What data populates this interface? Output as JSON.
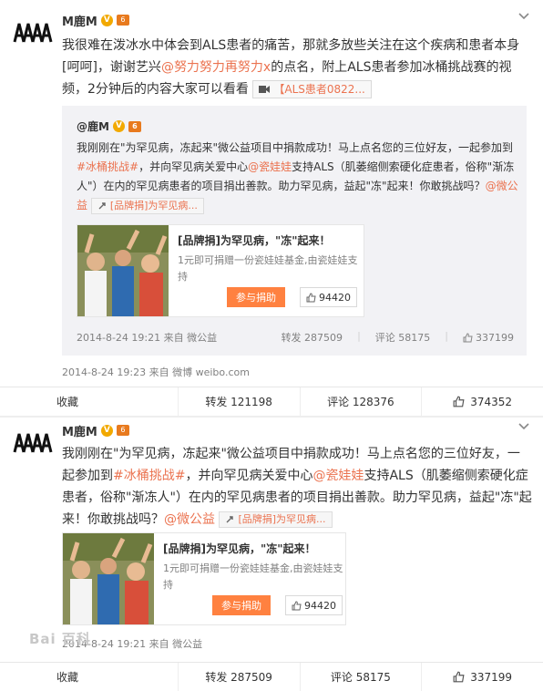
{
  "colors": {
    "accent": "#eb7350",
    "button": "#ff8140",
    "quote_bg": "#f2f2f5",
    "muted": "#808080"
  },
  "posts": [
    {
      "author": "M鹿M",
      "vip_badge": "V",
      "level_badge": "6",
      "text_parts": [
        "我很难在泼冰水中体会到ALS患者的痛苦，那就多放些关注在这个疾病和患者本身[呵呵]，谢谢艺兴",
        "@努力努力再努力x",
        "的点名，附上ALS患者参加冰桶挑战赛的视频，2分钟后的内容大家可以看看",
        "【ALS患者0822..."
      ],
      "quote": {
        "author": "@鹿M",
        "text_parts": [
          "我刚刚在\"为罕见病，冻起来\"微公益项目中捐款成功！马上点名您的三位好友，一起参加到",
          "#冰桶挑战#",
          "，并向罕见病关爱中心",
          "@瓷娃娃",
          "支持ALS（肌萎缩侧索硬化症患者，俗称\"渐冻人\"）在内的罕见病患者的项目捐出善款。助力罕见病，益起\"冻\"起来！你敢挑战吗？",
          "@微公益",
          "[品牌捐]为罕见病..."
        ],
        "card": {
          "title": "[品牌捐]为罕见病，\"冻\"起来！",
          "desc": "1元即可捐赠一份瓷娃娃基金,由瓷娃娃支持",
          "button": "参与捐助",
          "likes": "94420"
        },
        "time": "2014-8-24 19:21 来自 微公益",
        "repost": "转发 287509",
        "comment": "评论 58175",
        "likes": "337199"
      },
      "time": "2014-8-24 19:23 来自 微博 weibo.com",
      "actions": {
        "fav": "收藏",
        "repost": "转发 121198",
        "comment": "评论 128376",
        "likes": "374352"
      }
    },
    {
      "author": "M鹿M",
      "vip_badge": "V",
      "level_badge": "6",
      "text_parts": [
        "我刚刚在\"为罕见病，冻起来\"微公益项目中捐款成功！马上点名您的三位好友，一起参加到",
        "#冰桶挑战#",
        "，并向罕见病关爱中心",
        "@瓷娃娃",
        "支持ALS（肌萎缩侧索硬化症患者，俗称\"渐冻人\"）在内的罕见病患者的项目捐出善款。助力罕见病，益起\"冻\"起来！你敢挑战吗？",
        "@微公益",
        "[品牌捐]为罕见病..."
      ],
      "card": {
        "title": "[品牌捐]为罕见病，\"冻\"起来！",
        "desc": "1元即可捐赠一份瓷娃娃基金,由瓷娃娃支持",
        "button": "参与捐助",
        "likes": "94420"
      },
      "time": "2014-8-24 19:21 来自 微公益",
      "actions": {
        "fav": "收藏",
        "repost": "转发 287509",
        "comment": "评论 58175",
        "likes": "337199"
      }
    }
  ],
  "watermark": "Bai 百科"
}
